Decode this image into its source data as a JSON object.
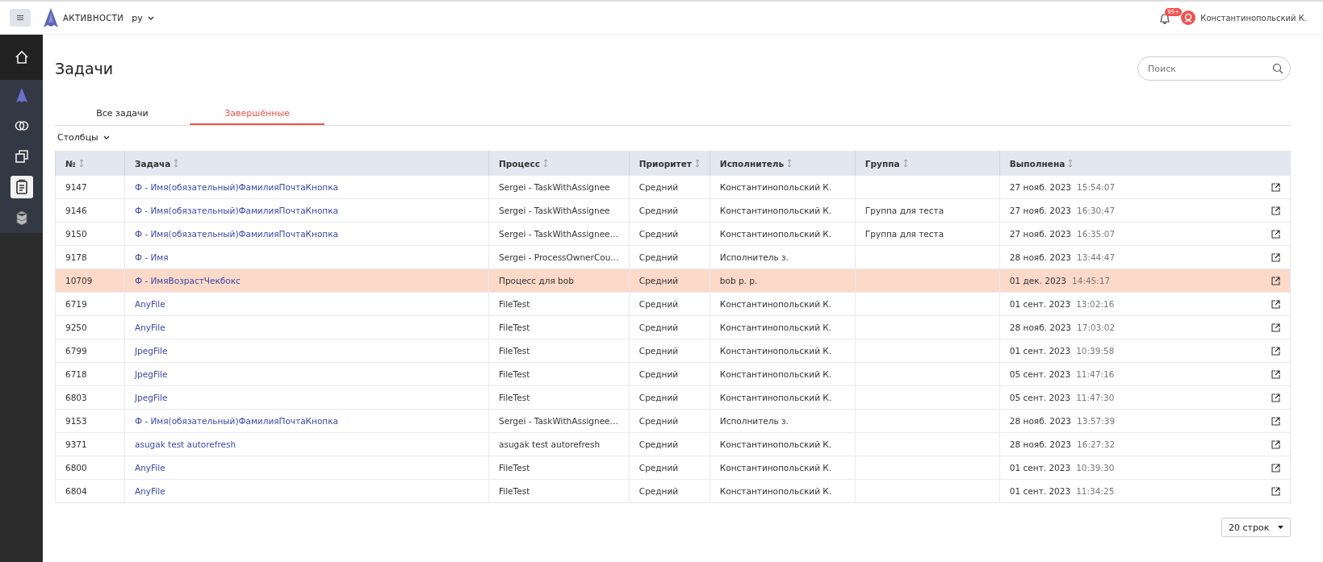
{
  "header": {
    "app_name": "АКТИВНОСТИ",
    "language": "ру",
    "notification_badge": "99+",
    "user_name": "Константинопольский К."
  },
  "sidebar": {
    "items": [
      {
        "kind": "home",
        "selected": false
      },
      {
        "kind": "logo",
        "selected": false
      },
      {
        "kind": "links",
        "selected": false
      },
      {
        "kind": "copies",
        "selected": false
      },
      {
        "kind": "clipboard",
        "selected": true
      },
      {
        "kind": "cubes",
        "selected": false
      }
    ]
  },
  "page": {
    "title": "Задачи",
    "search": {
      "placeholder": "Поиск"
    }
  },
  "tabs": [
    {
      "label": "Все задачи",
      "selected": false
    },
    {
      "label": "Завершённые",
      "selected": true
    }
  ],
  "columns_menu": "Столбцы",
  "table": {
    "columns": [
      "№",
      "Задача",
      "Процесс",
      "Приоритет",
      "Исполнитель",
      "Группа",
      "Выполнена"
    ],
    "rows": [
      {
        "id": "9147",
        "task": "Ф - Имя(обязательный)ФамилияПочтаКнопка",
        "process": "Sergei - TaskWithAssignee",
        "priority": "Средний",
        "assignee": "Константинопольский К.",
        "group": "",
        "date": "27 нояб. 2023",
        "time": "15:54:07",
        "selected": false
      },
      {
        "id": "9146",
        "task": "Ф - Имя(обязательный)ФамилияПочтаКнопка",
        "process": "Sergei - TaskWithAssignee",
        "priority": "Средний",
        "assignee": "Константинопольский К.",
        "group": "Группа для теста",
        "date": "27 нояб. 2023",
        "time": "16:30:47",
        "selected": false
      },
      {
        "id": "9150",
        "task": "Ф - Имя(обязательный)ФамилияПочтаКнопка",
        "process": "Sergei - TaskWithAssignee…",
        "priority": "Средний",
        "assignee": "Константинопольский К.",
        "group": "Группа для теста",
        "date": "27 нояб. 2023",
        "time": "16:35:07",
        "selected": false
      },
      {
        "id": "9178",
        "task": "Ф - Имя",
        "process": "Sergei - ProcessOwnerCou…",
        "priority": "Средний",
        "assignee": "Исполнитель з.",
        "group": "",
        "date": "28 нояб. 2023",
        "time": "13:44:47",
        "selected": false
      },
      {
        "id": "10709",
        "task": "Ф - ИмяВозрастЧекбокс",
        "process": "Процесс для bob",
        "priority": "Средний",
        "assignee": "bob p. p.",
        "group": "",
        "date": "01 дек. 2023",
        "time": "14:45:17",
        "selected": true
      },
      {
        "id": "6719",
        "task": "AnyFile",
        "process": "FileTest",
        "priority": "Средний",
        "assignee": "Константинопольский К.",
        "group": "",
        "date": "01 сент. 2023",
        "time": "13:02:16",
        "selected": false
      },
      {
        "id": "9250",
        "task": "AnyFile",
        "process": "FileTest",
        "priority": "Средний",
        "assignee": "Константинопольский К.",
        "group": "",
        "date": "28 нояб. 2023",
        "time": "17:03:02",
        "selected": false
      },
      {
        "id": "6799",
        "task": "JpegFile",
        "process": "FileTest",
        "priority": "Средний",
        "assignee": "Константинопольский К.",
        "group": "",
        "date": "01 сент. 2023",
        "time": "10:39:58",
        "selected": false
      },
      {
        "id": "6718",
        "task": "JpegFile",
        "process": "FileTest",
        "priority": "Средний",
        "assignee": "Константинопольский К.",
        "group": "",
        "date": "05 сент. 2023",
        "time": "11:47:16",
        "selected": false
      },
      {
        "id": "6803",
        "task": "JpegFile",
        "process": "FileTest",
        "priority": "Средний",
        "assignee": "Константинопольский К.",
        "group": "",
        "date": "05 сент. 2023",
        "time": "11:47:30",
        "selected": false
      },
      {
        "id": "9153",
        "task": "Ф - Имя(обязательный)ФамилияПочтаКнопка",
        "process": "Sergei - TaskWithAssignee…",
        "priority": "Средний",
        "assignee": "Исполнитель з.",
        "group": "",
        "date": "28 нояб. 2023",
        "time": "13:57:39",
        "selected": false
      },
      {
        "id": "9371",
        "task": "asugak test autorefresh",
        "process": "asugak test autorefresh",
        "priority": "Средний",
        "assignee": "Константинопольский К.",
        "group": "",
        "date": "28 нояб. 2023",
        "time": "16:27:32",
        "selected": false
      },
      {
        "id": "6800",
        "task": "AnyFile",
        "process": "FileTest",
        "priority": "Средний",
        "assignee": "Константинопольский К.",
        "group": "",
        "date": "01 сент. 2023",
        "time": "10:39:30",
        "selected": false
      },
      {
        "id": "6804",
        "task": "AnyFile",
        "process": "FileTest",
        "priority": "Средний",
        "assignee": "Константинопольский К.",
        "group": "",
        "date": "01 сент. 2023",
        "time": "11:34:25",
        "selected": false
      }
    ]
  },
  "pagination": {
    "rows_per_page": "20 строк"
  }
}
